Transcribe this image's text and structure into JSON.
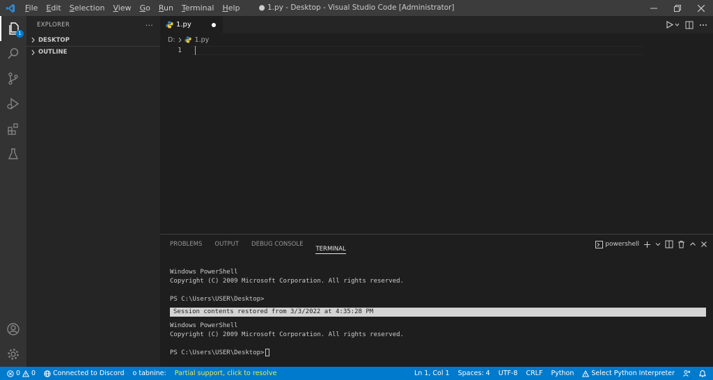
{
  "titlebar": {
    "title": "● 1.py - Desktop - Visual Studio Code [Administrator]",
    "menu": [
      {
        "mnemonic": "F",
        "rest": "ile"
      },
      {
        "mnemonic": "E",
        "rest": "dit"
      },
      {
        "mnemonic": "S",
        "rest": "election"
      },
      {
        "mnemonic": "V",
        "rest": "iew"
      },
      {
        "mnemonic": "G",
        "rest": "o"
      },
      {
        "mnemonic": "R",
        "rest": "un"
      },
      {
        "mnemonic": "T",
        "rest": "erminal"
      },
      {
        "mnemonic": "H",
        "rest": "elp"
      }
    ]
  },
  "activity": {
    "explorer_badge": "1"
  },
  "sidebar": {
    "header": "EXPLORER",
    "more": "···",
    "sections": [
      "DESKTOP",
      "OUTLINE"
    ]
  },
  "editor": {
    "tab_label": "1.py",
    "breadcrumb_drive": "D:",
    "breadcrumb_file": "1.py",
    "line_number": "1"
  },
  "panel": {
    "tabs": [
      "PROBLEMS",
      "OUTPUT",
      "DEBUG CONSOLE",
      "TERMINAL"
    ],
    "terminal_name": "powershell",
    "lines": [
      "Windows PowerShell",
      "Copyright (C) 2009 Microsoft Corporation. All rights reserved.",
      "",
      "PS C:\\Users\\USER\\Desktop>"
    ],
    "restored": "Session contents restored from 3/3/2022 at 4:35:28 PM",
    "lines_after": [
      "Windows PowerShell",
      "Copyright (C) 2009 Microsoft Corporation. All rights reserved.",
      "",
      "PS C:\\Users\\USER\\Desktop>"
    ]
  },
  "statusbar": {
    "errors": "0",
    "warnings": "0",
    "discord": "Connected to Discord",
    "tabnine": "o tabnine:",
    "tabnine_warning": "Partial support, click to resolve",
    "position": "Ln 1, Col 1",
    "spaces": "Spaces: 4",
    "encoding": "UTF-8",
    "eol": "CRLF",
    "language": "Python",
    "interpreter": "Select Python Interpreter"
  },
  "colors": {
    "accent": "#007acc",
    "titlebar": "#3c3c3c",
    "activitybar": "#333333",
    "sidebar": "#252526",
    "editor": "#1e1e1e",
    "warning_text": "#e8e85a"
  },
  "icons": {
    "activity": [
      "files-icon",
      "search-icon",
      "source-control-icon",
      "run-debug-icon",
      "extensions-icon",
      "testing-icon",
      "account-icon",
      "settings-gear-icon"
    ],
    "editor_actions": [
      "run-icon",
      "split-editor-icon",
      "more-actions-icon"
    ],
    "panel_actions": [
      "terminal-icon",
      "add-terminal-icon",
      "chevron-down-icon",
      "split-terminal-icon",
      "trash-icon",
      "maximize-panel-icon",
      "close-panel-icon"
    ],
    "statusbar": [
      "error-icon",
      "warning-icon",
      "globe-icon",
      "warning-triangle-icon",
      "feedback-icon",
      "bell-icon"
    ]
  }
}
